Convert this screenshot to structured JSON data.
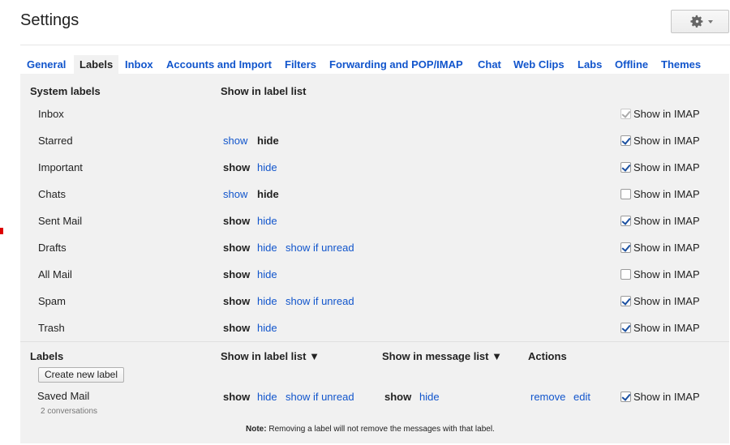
{
  "header": {
    "title": "Settings"
  },
  "tabs": [
    {
      "label": "General",
      "active": false
    },
    {
      "label": "Labels",
      "active": true
    },
    {
      "label": "Inbox",
      "active": false
    },
    {
      "label": "Accounts and Import",
      "active": false
    },
    {
      "label": "Filters",
      "active": false
    },
    {
      "label": "Forwarding and POP/IMAP",
      "active": false
    },
    {
      "label": "Chat",
      "active": false
    },
    {
      "label": "Web Clips",
      "active": false
    },
    {
      "label": "Labs",
      "active": false
    },
    {
      "label": "Offline",
      "active": false
    },
    {
      "label": "Themes",
      "active": false
    }
  ],
  "system_labels": {
    "header_name": "System labels",
    "header_show": "Show in label list",
    "rows": [
      {
        "name": "Inbox",
        "options": [],
        "imap_label": "Show in IMAP",
        "imap_checked": true,
        "imap_disabled": true
      },
      {
        "name": "Starred",
        "options": [
          {
            "text": "show",
            "selected": false
          },
          {
            "text": "hide",
            "selected": true
          }
        ],
        "imap_label": "Show in IMAP",
        "imap_checked": true
      },
      {
        "name": "Important",
        "options": [
          {
            "text": "show",
            "selected": true
          },
          {
            "text": "hide",
            "selected": false
          }
        ],
        "imap_label": "Show in IMAP",
        "imap_checked": true
      },
      {
        "name": "Chats",
        "options": [
          {
            "text": "show",
            "selected": false
          },
          {
            "text": "hide",
            "selected": true
          }
        ],
        "imap_label": "Show in IMAP",
        "imap_checked": false
      },
      {
        "name": "Sent Mail",
        "options": [
          {
            "text": "show",
            "selected": true
          },
          {
            "text": "hide",
            "selected": false
          }
        ],
        "imap_label": "Show in IMAP",
        "imap_checked": true
      },
      {
        "name": "Drafts",
        "options": [
          {
            "text": "show",
            "selected": true
          },
          {
            "text": "hide",
            "selected": false
          },
          {
            "text": "show if unread",
            "selected": false
          }
        ],
        "imap_label": "Show in IMAP",
        "imap_checked": true
      },
      {
        "name": "All Mail",
        "options": [
          {
            "text": "show",
            "selected": true
          },
          {
            "text": "hide",
            "selected": false
          }
        ],
        "imap_label": "Show in IMAP",
        "imap_checked": false
      },
      {
        "name": "Spam",
        "options": [
          {
            "text": "show",
            "selected": true
          },
          {
            "text": "hide",
            "selected": false
          },
          {
            "text": "show if unread",
            "selected": false
          }
        ],
        "imap_label": "Show in IMAP",
        "imap_checked": true
      },
      {
        "name": "Trash",
        "options": [
          {
            "text": "show",
            "selected": true
          },
          {
            "text": "hide",
            "selected": false
          }
        ],
        "imap_label": "Show in IMAP",
        "imap_checked": true
      }
    ]
  },
  "labels": {
    "header_name": "Labels",
    "header_label_list": "Show in label list ▼",
    "header_message_list": "Show in message list ▼",
    "header_actions": "Actions",
    "create_button": "Create new label",
    "rows": [
      {
        "name": "Saved Mail",
        "count": "2 conversations",
        "label_list": [
          {
            "text": "show",
            "selected": true
          },
          {
            "text": "hide",
            "selected": false
          },
          {
            "text": "show if unread",
            "selected": false
          }
        ],
        "message_list": [
          {
            "text": "show",
            "selected": true
          },
          {
            "text": "hide",
            "selected": false
          }
        ],
        "actions": [
          "remove",
          "edit"
        ],
        "imap_label": "Show in IMAP",
        "imap_checked": true
      }
    ],
    "note_bold": "Note:",
    "note_text": " Removing a label will not remove the messages with that label."
  }
}
